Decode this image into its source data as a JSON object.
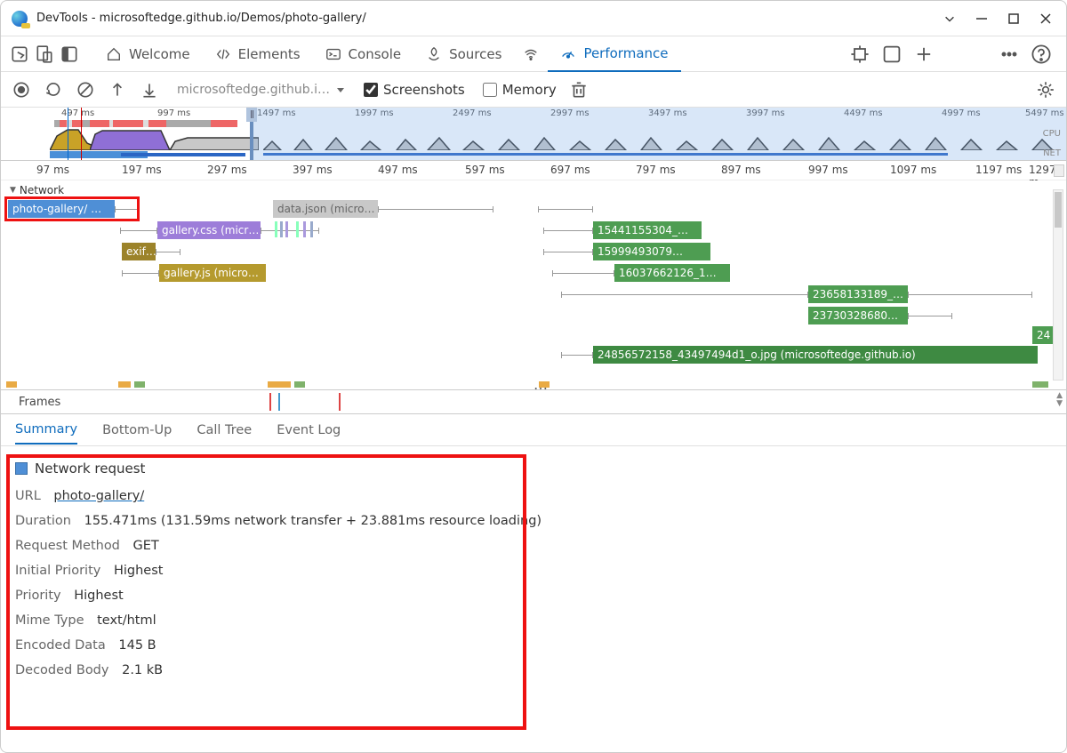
{
  "window": {
    "title": "DevTools - microsoftedge.github.io/Demos/photo-gallery/"
  },
  "tabs": {
    "welcome": "Welcome",
    "elements": "Elements",
    "console": "Console",
    "sources": "Sources",
    "performance": "Performance"
  },
  "toolbar": {
    "url": "microsoftedge.github.i…",
    "screenshots_label": "Screenshots",
    "memory_label": "Memory"
  },
  "overview": {
    "ticks": [
      "497 ms",
      "997 ms",
      "1497 ms",
      "1997 ms",
      "2497 ms",
      "2997 ms",
      "3497 ms",
      "3997 ms",
      "4497 ms",
      "4997 ms",
      "5497 ms"
    ],
    "cpu_label": "CPU",
    "net_label": "NET"
  },
  "ruler": {
    "ticks": [
      "97 ms",
      "197 ms",
      "297 ms",
      "397 ms",
      "497 ms",
      "597 ms",
      "697 ms",
      "797 ms",
      "897 ms",
      "997 ms",
      "1097 ms",
      "1197 ms",
      "1297 m"
    ]
  },
  "tracks": {
    "network_label": "Network",
    "requests": {
      "photo_gallery": "photo-gallery/ …",
      "gallery_css": "gallery.css (micr…",
      "exif": "exif…",
      "gallery_js": "gallery.js (micro…",
      "data_json": "data.json (micro…",
      "img1": "15441155304_…",
      "img2": "15999493079…",
      "img3": "16037662126_1…",
      "img4": "23658133189_…",
      "img5": "23730328680…",
      "img6": "24",
      "imgbig": "24856572158_43497494d1_o.jpg (microsoftedge.github.io)"
    }
  },
  "frames": {
    "label": "Frames"
  },
  "detail_tabs": {
    "summary": "Summary",
    "bottom_up": "Bottom-Up",
    "call_tree": "Call Tree",
    "event_log": "Event Log"
  },
  "summary": {
    "title": "Network request",
    "url_label": "URL",
    "url_value": "photo-gallery/",
    "duration_label": "Duration",
    "duration_value": "155.471ms (131.59ms network transfer + 23.881ms resource loading)",
    "method_label": "Request Method",
    "method_value": "GET",
    "init_priority_label": "Initial Priority",
    "init_priority_value": "Highest",
    "priority_label": "Priority",
    "priority_value": "Highest",
    "mime_label": "Mime Type",
    "mime_value": "text/html",
    "encoded_label": "Encoded Data",
    "encoded_value": "145 B",
    "decoded_label": "Decoded Body",
    "decoded_value": "2.1 kB"
  }
}
